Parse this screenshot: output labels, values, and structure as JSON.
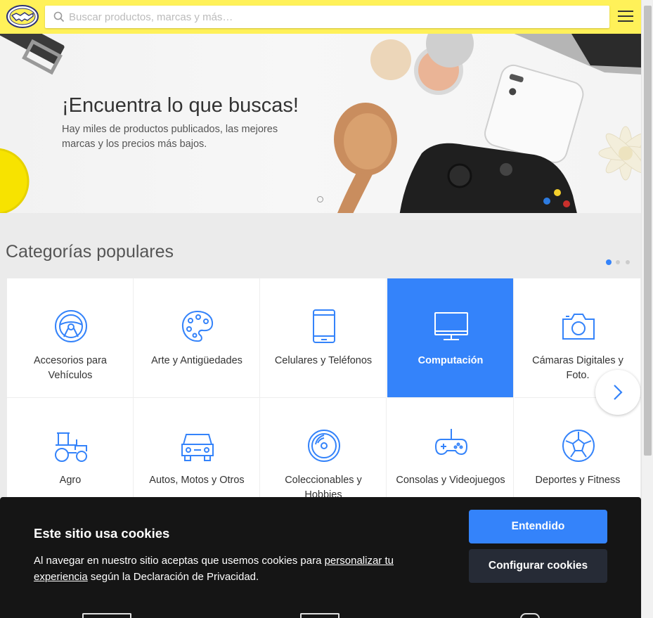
{
  "header": {
    "search_placeholder": "Buscar productos, marcas y más…",
    "brand_color": "#fff159"
  },
  "hero": {
    "title": "¡Encuentra lo que buscas!",
    "subtitle": "Hay miles de productos publicados, las mejores marcas y los precios más bajos."
  },
  "categories": {
    "title": "Categorías populares",
    "accent": "#3483fa",
    "items": [
      {
        "label": "Accesorios para Vehículos",
        "icon": "steering-wheel-icon"
      },
      {
        "label": "Arte y Antigüedades",
        "icon": "palette-icon"
      },
      {
        "label": "Celulares y Teléfonos",
        "icon": "phone-icon"
      },
      {
        "label": "Computación",
        "icon": "monitor-icon",
        "active": true
      },
      {
        "label": "Cámaras Digitales y Foto.",
        "icon": "camera-icon"
      },
      {
        "label": "Agro",
        "icon": "tractor-icon"
      },
      {
        "label": "Autos, Motos y Otros",
        "icon": "car-icon"
      },
      {
        "label": "Coleccionables y Hobbies",
        "icon": "disc-icon"
      },
      {
        "label": "Consolas y Videojuegos",
        "icon": "gamepad-icon"
      },
      {
        "label": "Deportes y Fitness",
        "icon": "soccer-ball-icon"
      }
    ]
  },
  "cookie": {
    "title": "Este sitio usa cookies",
    "text_before": "Al navegar en nuestro sitio aceptas que usemos cookies para ",
    "link": "personalizar tu experiencia",
    "text_after": " según la Declaración de Privacidad.",
    "accept_label": "Entendido",
    "config_label": "Configurar cookies"
  }
}
